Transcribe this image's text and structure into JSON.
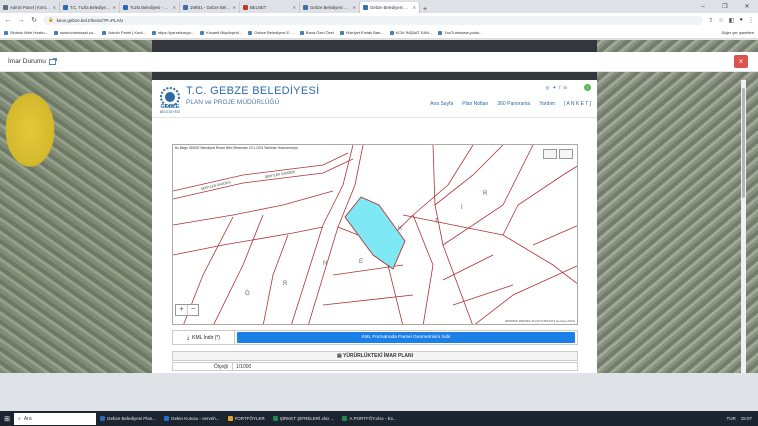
{
  "browser": {
    "tabs": [
      {
        "label": "Admin Panel | Kontrol Panel",
        "color": "#5a6d82"
      },
      {
        "label": "T.C. Tuzla Belediyesi Resmi Web",
        "color": "#2a6ab0"
      },
      {
        "label": "Tuzla Belediyesi - NetGIS Harita",
        "color": "#2a6ab0"
      },
      {
        "label": "198/41 - Gebze Belediyesi E-İmar",
        "color": "#3d6fa8"
      },
      {
        "label": "BELNET",
        "color": "#c0392b"
      },
      {
        "label": "Gebze Belediyesi E-İmar Uygulama",
        "color": "#3d6fa8"
      },
      {
        "label": "Gebze Belediyesi Plan Sayfası",
        "color": "#3d6fa8",
        "active": true
      }
    ],
    "new_tab": "+",
    "url": "keos.gebze.bel.tr/keos/?P=PLAN",
    "bookmarks": [
      "Sinirsiz Web Hostin...",
      "www.kominsaat.co...",
      "Admin Panel | Kont...",
      "https://parselsorgu...",
      "Kocaeli Büyükşehi...",
      "Gebze Belediyesi E-...",
      "Bana Özel Özel",
      "Hürriyet Emlak Ban...",
      "KCM İNŞAAT SAN...",
      "YouTubewww.youtu..."
    ],
    "other_bookmarks": "Diğer yer işaretleri"
  },
  "modal": {
    "title": "İmar Durumu",
    "close": "×"
  },
  "site": {
    "logo_text": "GEBZE BELEDİYESİ",
    "logo_top": "GEBZE",
    "logo_bottom": "BELEDİYESİ",
    "org_name": "T.C. GEBZE BELEDİYESİ",
    "org_unit": "PLAN ve PROJE MÜDÜRLÜĞÜ",
    "menu": [
      "Ana Sayfa",
      "Plan Notları",
      "360 Panorama",
      "Yardım",
      "[ A N K E T ]"
    ]
  },
  "map": {
    "note": "Bu Belge GEBZE Belediyesi Resmi Web Sitesinden 20.1.2023 Tarihinde Hazırlanmıştır.",
    "road_labels": [
      "ŞEHİTLER CADDESİ",
      "ŞEHİTLER CADDESİ"
    ],
    "area_letters": [
      "Ö",
      "R",
      "N",
      "E",
      "K",
      "T",
      "İ",
      "R"
    ],
    "zoom_in": "+",
    "zoom_out": "−",
    "coordinates": "(4564835 4832093-4714773 8044473 Hectare 2023)"
  },
  "actions": {
    "kml_label": "KML İndir (*)",
    "xml_label": "XML Formatında Parsel Geometrisini İndir"
  },
  "plan": {
    "heading": "YÜRÜRLÜKTEKİ İMAR PLANI",
    "rows": [
      {
        "key": "Ölçeği",
        "value": "1/1000"
      }
    ]
  },
  "taskbar": {
    "search": "Ara",
    "items": [
      {
        "label": "Gebze Belediyesi Plan...",
        "color": "#2a6ab0"
      },
      {
        "label": "Gelen Kutusu - serveh...",
        "color": "#1e70c8"
      },
      {
        "label": "FORTFÖYLER",
        "color": "#e0a526"
      },
      {
        "label": "ŞİRKET ŞİFRELERİ.xlsx ...",
        "color": "#1f8a4c"
      },
      {
        "label": "A.PORTFÖY.xlsx - Ex...",
        "color": "#1f8a4c"
      }
    ],
    "lang": "TUR",
    "time": "15:07"
  },
  "colors": {
    "accent": "#2c6aa5",
    "xml_button": "#1a7fe6",
    "close_button": "#d9534f",
    "parcel_highlight": "#7fe8f5",
    "parcel_line": "#b33333"
  }
}
